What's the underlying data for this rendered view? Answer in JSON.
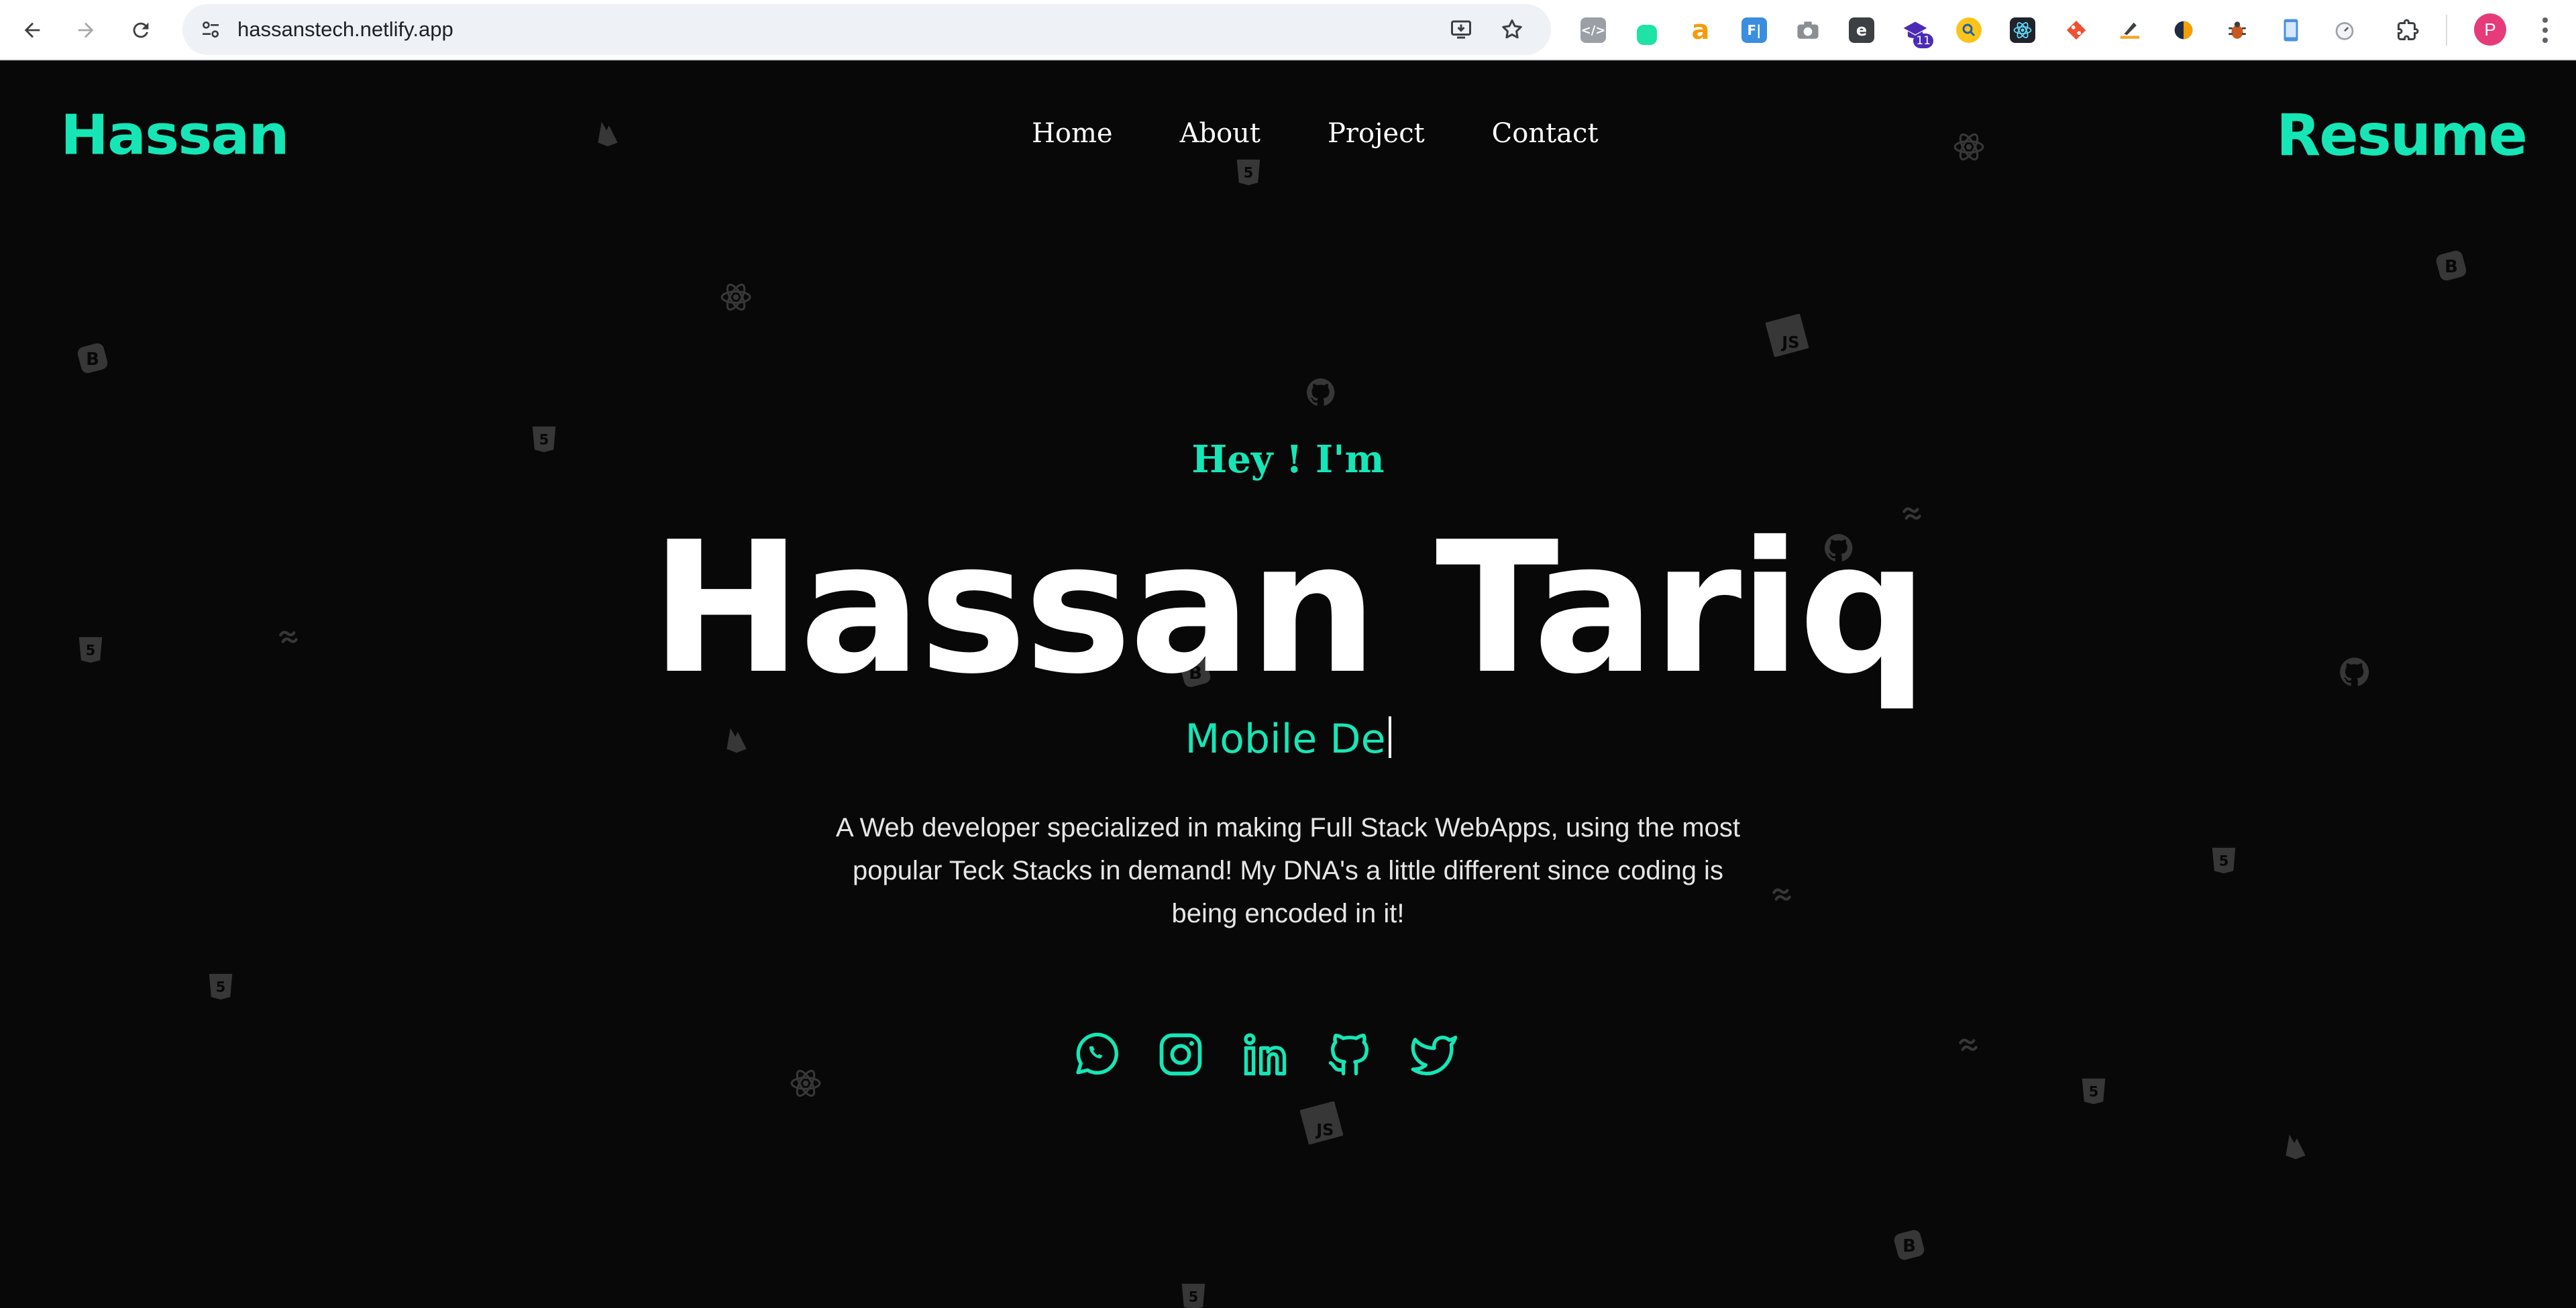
{
  "browser": {
    "url": "hassanstech.netlify.app",
    "extension_badge": "11",
    "profile_initial": "P"
  },
  "site": {
    "brand": "Hassan",
    "nav": [
      "Home",
      "About",
      "Project",
      "Contact"
    ],
    "resume": "Resume",
    "greeting": "Hey ! I'm",
    "name": "Hassan Tariq",
    "role_typed": "Mobile De",
    "description": "A Web developer specialized in making Full Stack WebApps, using the most popular Teck Stacks in demand! My DNA's a little different since coding is being encoded in it!",
    "socials": [
      "whatsapp-icon",
      "instagram-icon",
      "linkedin-icon",
      "github-icon",
      "twitter-icon"
    ],
    "accent": "#16e6b6",
    "background": "#080808"
  },
  "floating_icons": [
    "firebase",
    "html5",
    "react",
    "bootstrap",
    "javascript",
    "github",
    "tailwind"
  ]
}
